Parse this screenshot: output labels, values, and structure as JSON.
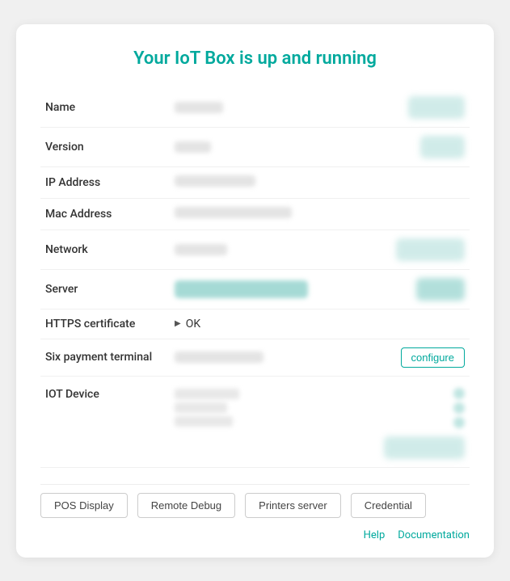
{
  "title": "Your IoT Box is up and running",
  "fields": {
    "name": {
      "label": "Name"
    },
    "version": {
      "label": "Version"
    },
    "ip_address": {
      "label": "IP Address"
    },
    "mac_address": {
      "label": "Mac Address"
    },
    "network": {
      "label": "Network"
    },
    "server": {
      "label": "Server"
    },
    "https_certificate": {
      "label": "HTTPS certificate",
      "value": "OK"
    },
    "six_payment": {
      "label": "Six payment terminal",
      "configure_btn": "configure"
    },
    "iot_device": {
      "label": "IOT Device"
    }
  },
  "footer_buttons": [
    {
      "id": "pos-display",
      "label": "POS Display"
    },
    {
      "id": "remote-debug",
      "label": "Remote Debug"
    },
    {
      "id": "printers-server",
      "label": "Printers server"
    },
    {
      "id": "credential",
      "label": "Credential"
    }
  ],
  "footer_links": [
    {
      "id": "help",
      "label": "Help"
    },
    {
      "id": "documentation",
      "label": "Documentation"
    }
  ]
}
